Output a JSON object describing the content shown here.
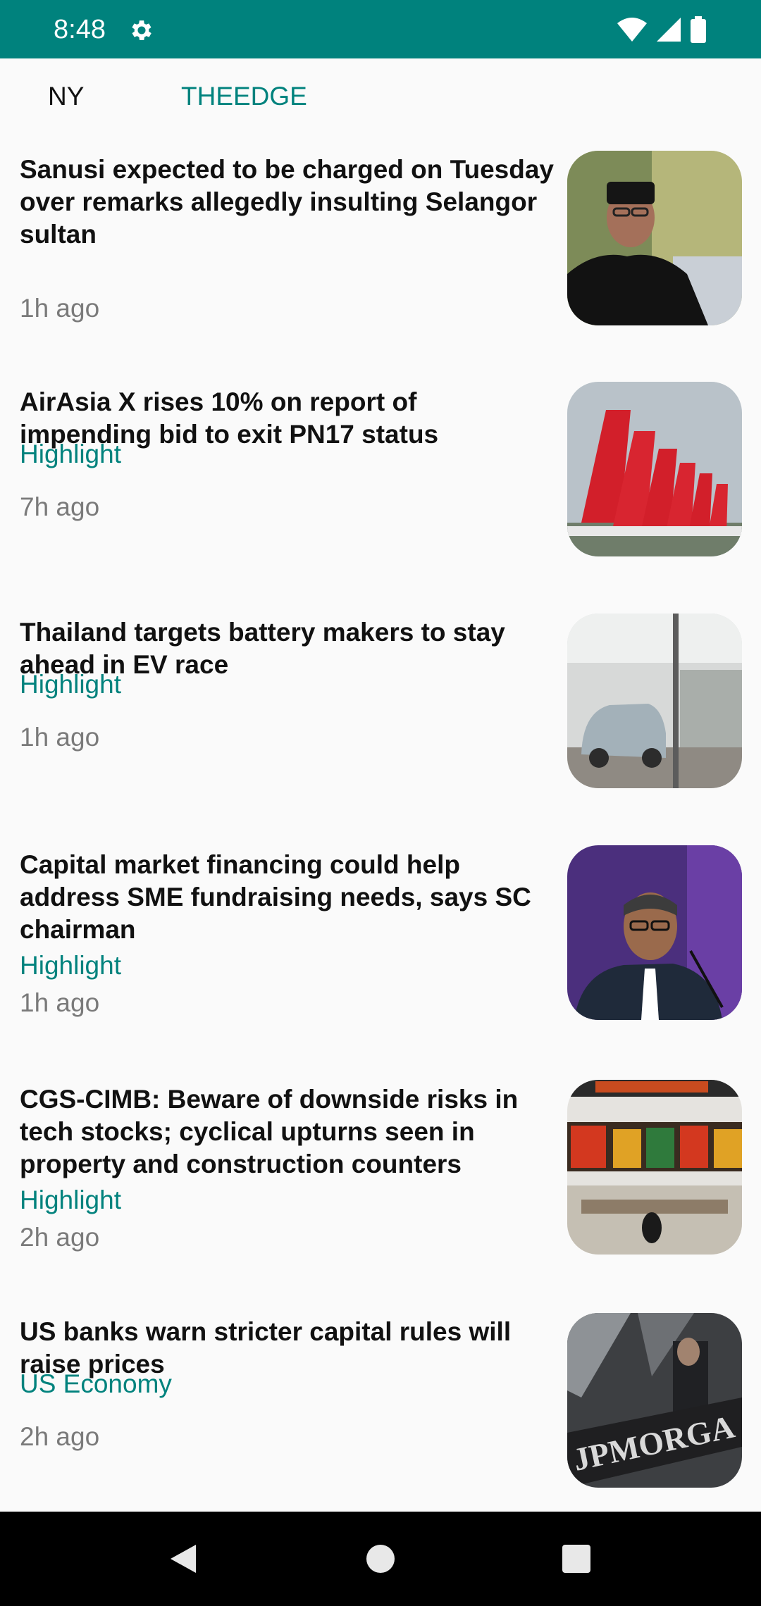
{
  "status_bar": {
    "time": "8:48"
  },
  "tabs": [
    {
      "label": "NY"
    },
    {
      "label": "THEEDGE"
    }
  ],
  "colors": {
    "accent": "#00827d",
    "status_bar": "#00827d",
    "nav_bar": "#000000"
  },
  "articles": [
    {
      "title": "Sanusi expected to be charged on Tuesday over remarks allegedly insulting Selangor sultan",
      "category": "",
      "time": "1h ago"
    },
    {
      "title": "AirAsia X rises 10% on report of impending bid to exit PN17 status",
      "category": "Highlight",
      "time": "7h ago"
    },
    {
      "title": "Thailand targets battery makers to stay ahead in EV race",
      "category": "Highlight",
      "time": "1h ago"
    },
    {
      "title": "Capital market financing could help address SME fundraising needs, says SC chairman",
      "category": "Highlight",
      "time": "1h ago"
    },
    {
      "title": "CGS-CIMB: Beware of downside risks in tech stocks; cyclical upturns seen in property and construction counters",
      "category": "Highlight",
      "time": "2h ago"
    },
    {
      "title": "US banks warn stricter capital rules will raise prices",
      "category": "US Economy",
      "time": "2h ago"
    }
  ],
  "images": {
    "jpmorgan_sign": "JPMORGA"
  },
  "icons": [
    "settings-gear-icon",
    "wifi-icon",
    "cell-signal-icon",
    "battery-icon",
    "back-icon",
    "home-icon",
    "recents-icon"
  ]
}
